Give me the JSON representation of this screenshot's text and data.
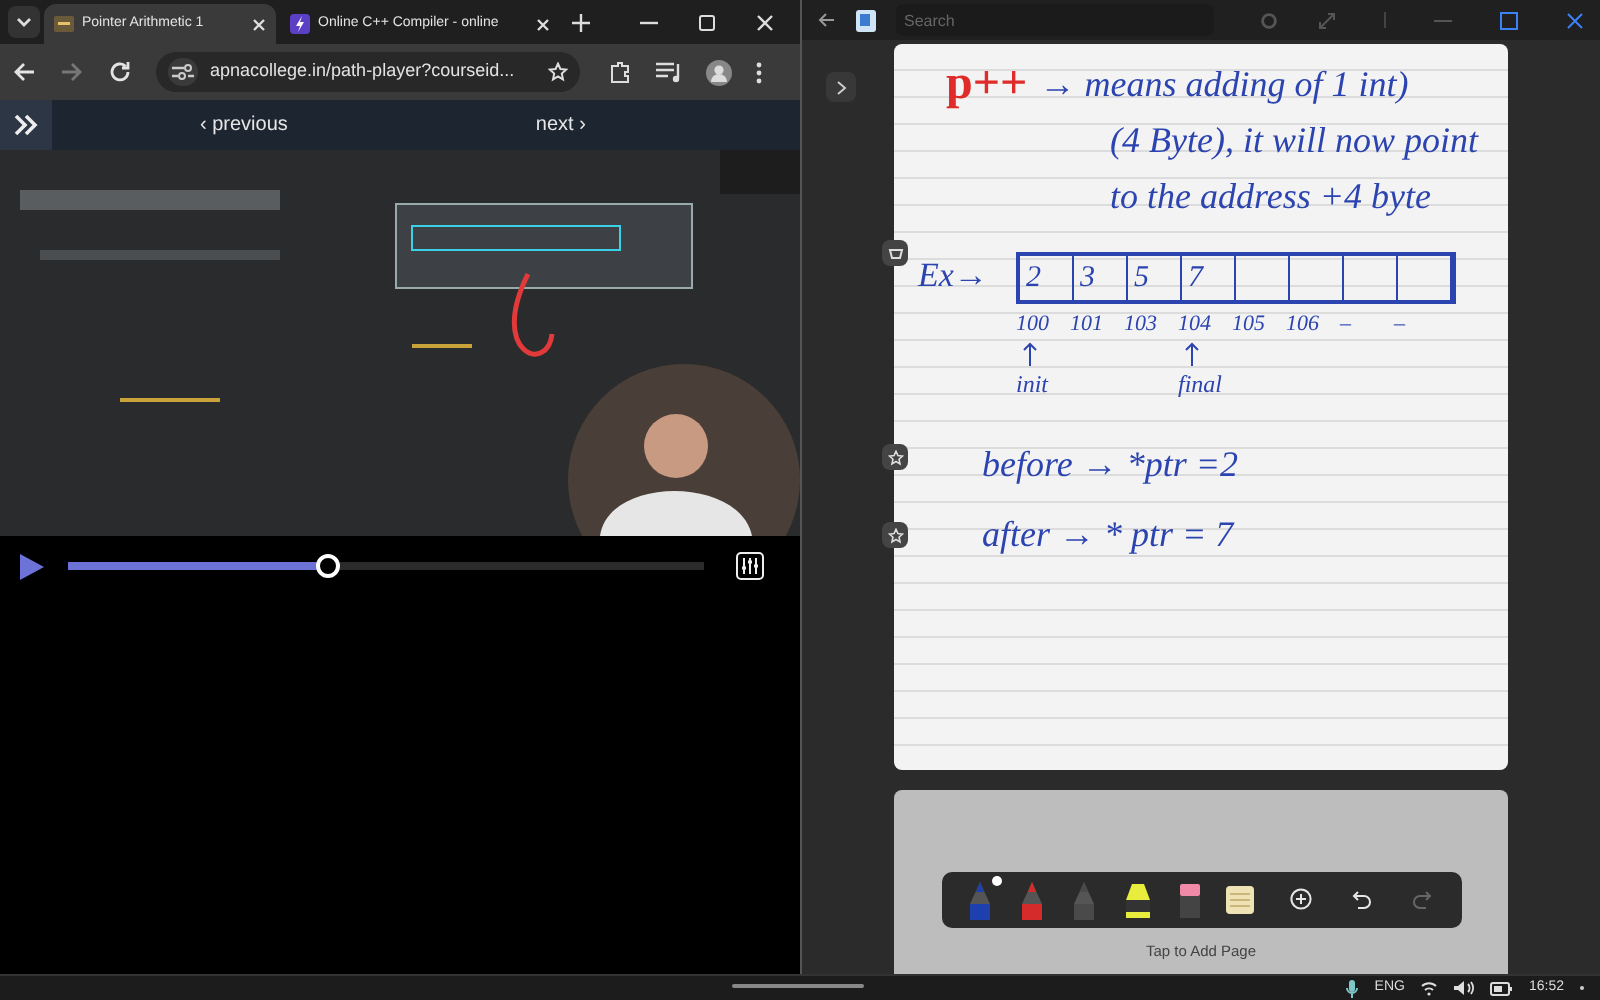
{
  "browser": {
    "tabs": [
      {
        "title": "Pointer Arithmetic 1",
        "selected": true
      },
      {
        "title": "Online C++ Compiler - online",
        "selected": false
      }
    ],
    "url": "apnacollege.in/path-player?courseid...",
    "nav": {
      "previous": "‹ previous",
      "next": "next ›"
    },
    "player": {
      "level": 0.41
    }
  },
  "notes": {
    "search": {
      "placeholder": "Search"
    },
    "lines": [
      {
        "segments": [
          {
            "text": "p++",
            "color": "#e02b2b"
          },
          {
            "text": "→ means adding of 1 int)",
            "color": "#2c44b0"
          }
        ]
      },
      {
        "segments": [
          {
            "text": "(4 Byte), it will now point",
            "color": "#2c44b0"
          }
        ]
      },
      {
        "segments": [
          {
            "text": "to the address +4 byte",
            "color": "#2c44b0"
          }
        ]
      }
    ],
    "example": {
      "label": "Ex→",
      "cells": [
        "2",
        "3",
        "5",
        "7"
      ],
      "addresses": [
        {
          "text": "100",
          "marker": "init"
        },
        {
          "text": "101"
        },
        {
          "text": "103"
        },
        {
          "text": "104",
          "marker": "final"
        },
        {
          "text": "105"
        },
        {
          "text": "106"
        },
        {
          "text": "–"
        },
        {
          "text": "–"
        }
      ]
    },
    "results": [
      "before → *ptr =2",
      "after → * ptr = 7"
    ],
    "tools": [
      {
        "kind": "pen",
        "color": "#1e3fae",
        "selected": true
      },
      {
        "kind": "pen",
        "color": "#d62b2b",
        "selected": false
      },
      {
        "kind": "pen",
        "color": "#4a4a4a",
        "selected": false
      },
      {
        "kind": "highlighter",
        "color": "#e8ec3c",
        "selected": false
      },
      {
        "kind": "eraser",
        "color": "#f08aa8",
        "selected": false
      },
      {
        "kind": "paper",
        "color": "#efe2b4",
        "selected": false
      }
    ],
    "actions": [
      {
        "kind": "add",
        "disabled": false
      },
      {
        "kind": "undo",
        "disabled": false
      },
      {
        "kind": "redo",
        "disabled": true
      }
    ],
    "add_page": "Tap to Add Page"
  },
  "taskbar": {
    "language": "ENG",
    "time": "16:52"
  }
}
